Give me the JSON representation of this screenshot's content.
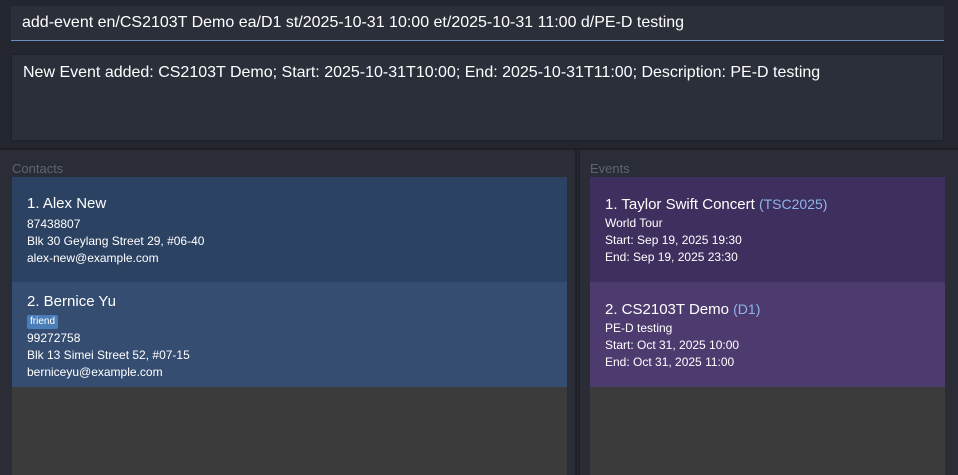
{
  "command": {
    "value": "add-event en/CS2103T Demo ea/D1 st/2025-10-31 10:00 et/2025-10-31 11:00 d/PE-D testing"
  },
  "result": {
    "text": "New Event added: CS2103T Demo; Start: 2025-10-31T10:00; End: 2025-10-31T11:00; Description: PE-D testing"
  },
  "contacts": {
    "label": "Contacts",
    "items": [
      {
        "title": "1. Alex New",
        "tag": "",
        "phone": "87438807",
        "address": "Blk 30 Geylang Street 29, #06-40",
        "email": "alex-new@example.com"
      },
      {
        "title": "2. Bernice Yu",
        "tag": "friend",
        "phone": "99272758",
        "address": "Blk 13 Simei Street 52, #07-15",
        "email": "berniceyu@example.com"
      }
    ]
  },
  "events": {
    "label": "Events",
    "items": [
      {
        "title": "1. Taylor Swift Concert",
        "code": "(TSC2025)",
        "description": "World Tour",
        "start": "Start: Sep 19, 2025 19:30",
        "end": "End: Sep 19, 2025 23:30"
      },
      {
        "title": "2. CS2103T Demo",
        "code": "(D1)",
        "description": "PE-D testing",
        "start": "Start: Oct 31, 2025 10:00",
        "end": "End: Oct 31, 2025 11:00"
      }
    ]
  },
  "colors": {
    "contact_card_1": "#2c4263",
    "contact_card_2": "#354d70",
    "event_card_1": "#3e2f5e",
    "event_card_2": "#4d3b70",
    "tag": "#4a7eb8",
    "code": "#8fb4e8"
  }
}
